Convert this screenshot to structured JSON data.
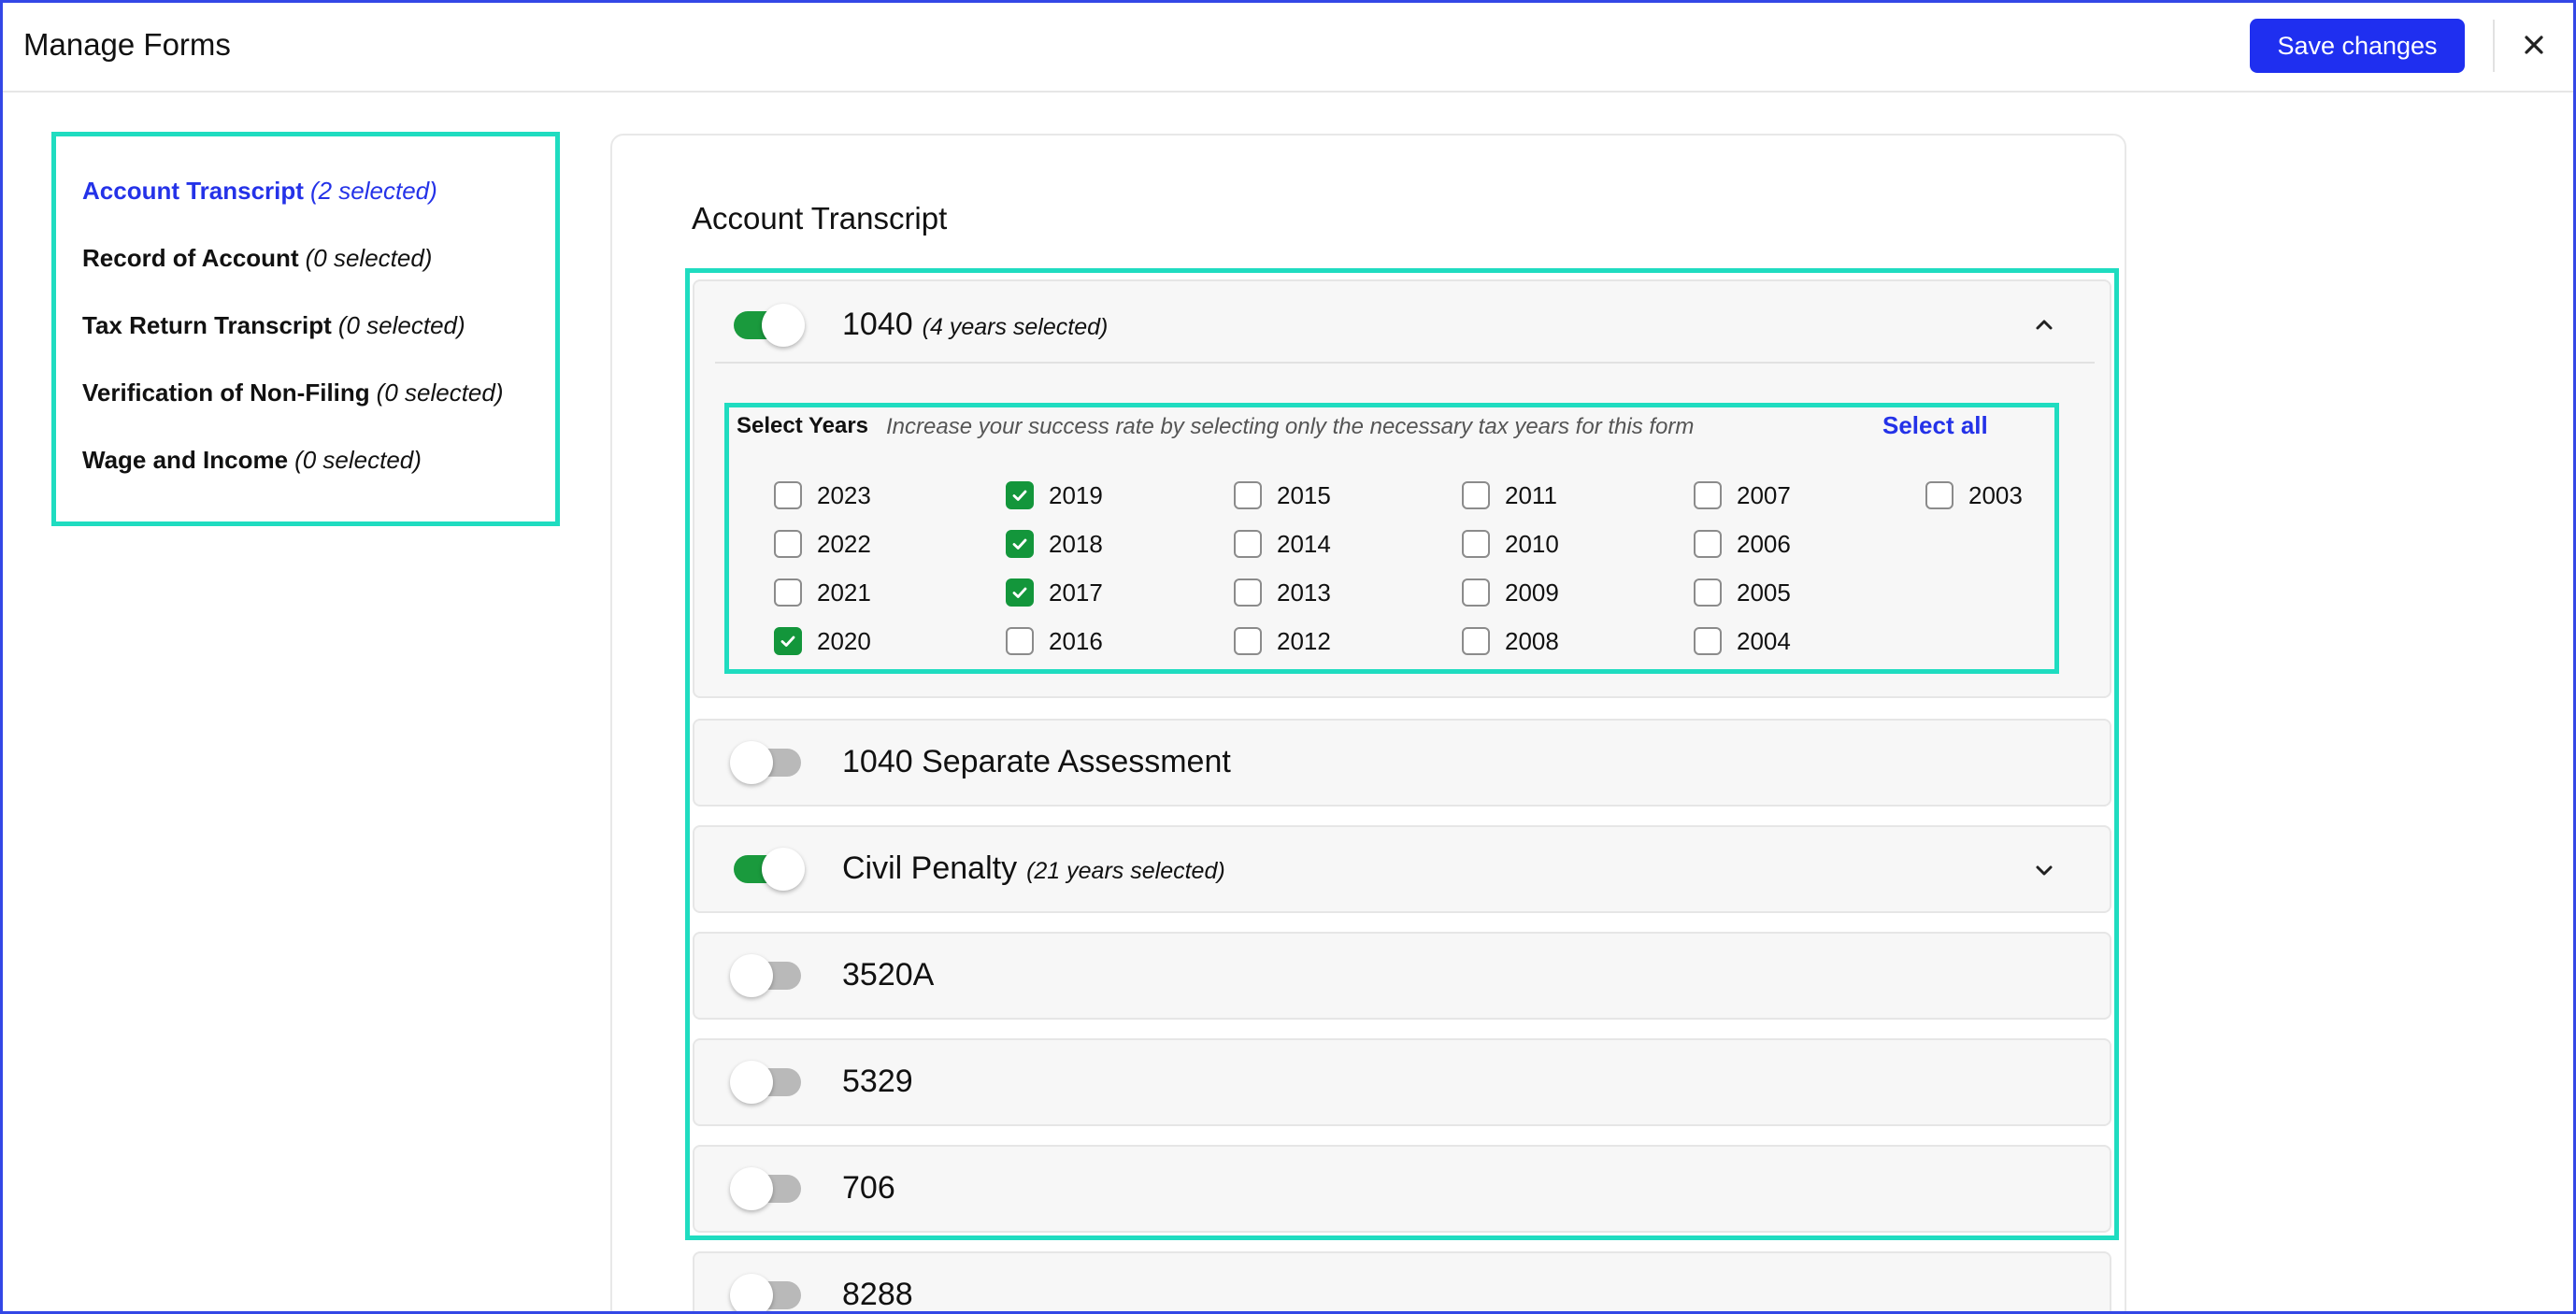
{
  "header": {
    "title": "Manage Forms",
    "save_label": "Save changes",
    "close_icon": "close-icon"
  },
  "colors": {
    "accent": "#1f2ff0",
    "toggle_on": "#1a9a3d",
    "highlight_border": "#1fdcc0",
    "link": "#2432e8"
  },
  "sidebar": {
    "items": [
      {
        "label": "Account Transcript",
        "count": "(2 selected)",
        "active": true
      },
      {
        "label": "Record of Account",
        "count": "(0 selected)",
        "active": false
      },
      {
        "label": "Tax Return Transcript",
        "count": "(0 selected)",
        "active": false
      },
      {
        "label": "Verification of Non-Filing",
        "count": "(0 selected)",
        "active": false
      },
      {
        "label": "Wage and Income",
        "count": "(0 selected)",
        "active": false
      }
    ]
  },
  "main": {
    "section_title": "Account Transcript",
    "forms": [
      {
        "name": "1040",
        "sub": "(4 years selected)",
        "enabled": true,
        "expanded": true
      },
      {
        "name": "1040 Separate Assessment",
        "sub": "",
        "enabled": false,
        "expanded": false
      },
      {
        "name": "Civil Penalty",
        "sub": "(21 years selected)",
        "enabled": true,
        "expanded": false
      },
      {
        "name": "3520A",
        "sub": "",
        "enabled": false,
        "expanded": false
      },
      {
        "name": "5329",
        "sub": "",
        "enabled": false,
        "expanded": false
      },
      {
        "name": "706",
        "sub": "",
        "enabled": false,
        "expanded": false
      },
      {
        "name": "8288",
        "sub": "",
        "enabled": false,
        "expanded": false
      }
    ],
    "year_picker": {
      "label": "Select Years",
      "hint": "Increase your success rate by selecting only the necessary tax years for this form",
      "select_all": "Select all",
      "columns": [
        [
          {
            "year": "2023",
            "checked": false
          },
          {
            "year": "2022",
            "checked": false
          },
          {
            "year": "2021",
            "checked": false
          },
          {
            "year": "2020",
            "checked": true
          }
        ],
        [
          {
            "year": "2019",
            "checked": true
          },
          {
            "year": "2018",
            "checked": true
          },
          {
            "year": "2017",
            "checked": true
          },
          {
            "year": "2016",
            "checked": false
          }
        ],
        [
          {
            "year": "2015",
            "checked": false
          },
          {
            "year": "2014",
            "checked": false
          },
          {
            "year": "2013",
            "checked": false
          },
          {
            "year": "2012",
            "checked": false
          }
        ],
        [
          {
            "year": "2011",
            "checked": false
          },
          {
            "year": "2010",
            "checked": false
          },
          {
            "year": "2009",
            "checked": false
          },
          {
            "year": "2008",
            "checked": false
          }
        ],
        [
          {
            "year": "2007",
            "checked": false
          },
          {
            "year": "2006",
            "checked": false
          },
          {
            "year": "2005",
            "checked": false
          },
          {
            "year": "2004",
            "checked": false
          }
        ],
        [
          {
            "year": "2003",
            "checked": false
          }
        ]
      ]
    }
  }
}
